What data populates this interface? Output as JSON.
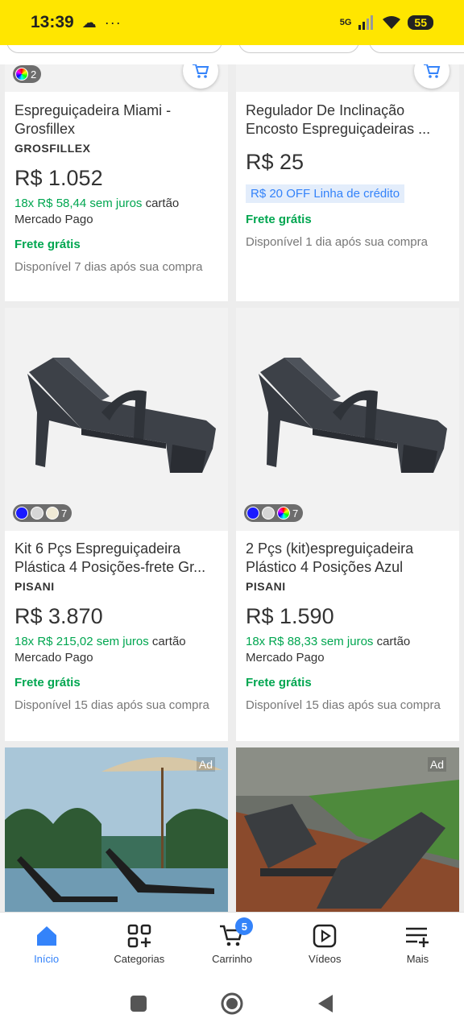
{
  "status_bar": {
    "time": "13:39",
    "network": "5G",
    "battery": "55"
  },
  "products": [
    {
      "title": "Espreguiçadeira Miami - Grosfillex",
      "brand": "GROSFILLEX",
      "price": "R$ 1.052",
      "installments_green": "18x R$ 58,44 sem juros",
      "installments_rest": " cartão Mercado Pago",
      "shipping": "Frete grátis",
      "availability": "Disponível 7 dias após sua compra",
      "swatch_count": "2"
    },
    {
      "title": "Regulador De Inclinação Encosto Espreguiçadeiras ...",
      "price": "R$ 25",
      "discount_badge": "R$ 20 OFF Linha de crédito",
      "shipping": "Frete grátis",
      "availability": "Disponível 1 dia após sua compra"
    },
    {
      "title": "Kit 6 Pçs Espreguiçadeira Plástica 4 Posições-frete Gr...",
      "brand": "PISANI",
      "price": "R$ 3.870",
      "installments_green": "18x R$ 215,02 sem juros",
      "installments_rest": " cartão Mercado Pago",
      "shipping": "Frete grátis",
      "availability": "Disponível 15 dias após sua compra",
      "swatch_count": "7"
    },
    {
      "title": "2 Pçs (kit)espreguiçadeira Plástico 4 Posições Azul",
      "brand": "PISANI",
      "price": "R$ 1.590",
      "installments_green": "18x R$ 88,33 sem juros",
      "installments_rest": " cartão Mercado Pago",
      "shipping": "Frete grátis",
      "availability": "Disponível 15 dias após sua compra",
      "swatch_count": "7"
    }
  ],
  "ads": [
    {
      "tag": "Ad"
    },
    {
      "tag": "Ad"
    }
  ],
  "bottom_nav": [
    {
      "label": "Início",
      "icon": "home-icon",
      "active": true
    },
    {
      "label": "Categorias",
      "icon": "categories-icon"
    },
    {
      "label": "Carrinho",
      "icon": "cart-icon",
      "badge": "5"
    },
    {
      "label": "Vídeos",
      "icon": "video-icon"
    },
    {
      "label": "Mais",
      "icon": "more-menu-icon"
    }
  ],
  "colors": {
    "accent": "#3483fa",
    "green": "#00a650",
    "brand_yellow": "#ffe600"
  }
}
